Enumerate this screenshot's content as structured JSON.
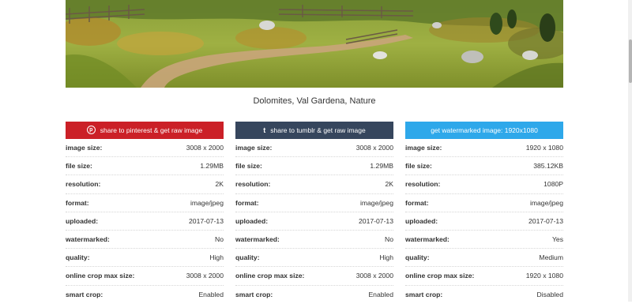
{
  "photo": {
    "alt": "Dolomites, Val Gardena, Nature"
  },
  "caption": "Dolomites, Val Gardena, Nature",
  "buttons": {
    "pinterest": "share to pinterest & get raw image",
    "tumblr": "share to tumblr & get raw image",
    "watermarked": "get watermarked image: 1920x1080"
  },
  "icons": {
    "pinterest": "p-icon",
    "tumblr": "t-icon"
  },
  "colors": {
    "pinterest": "#cb2027",
    "tumblr": "#36465d",
    "watermark": "#2ea8ea"
  },
  "labels": {
    "image_size": "image size:",
    "file_size": "file size:",
    "resolution": "resolution:",
    "format": "format:",
    "uploaded": "uploaded:",
    "watermarked": "watermarked:",
    "quality": "quality:",
    "crop_max": "online crop max size:",
    "smart_crop": "smart crop:"
  },
  "columns": [
    {
      "image_size": "3008 x 2000",
      "file_size": "1.29MB",
      "resolution": "2K",
      "format": "image/jpeg",
      "uploaded": "2017-07-13",
      "watermarked": "No",
      "quality": "High",
      "crop_max": "3008 x 2000",
      "smart_crop": "Enabled"
    },
    {
      "image_size": "3008 x 2000",
      "file_size": "1.29MB",
      "resolution": "2K",
      "format": "image/jpeg",
      "uploaded": "2017-07-13",
      "watermarked": "No",
      "quality": "High",
      "crop_max": "3008 x 2000",
      "smart_crop": "Enabled"
    },
    {
      "image_size": "1920 x 1080",
      "file_size": "385.12KB",
      "resolution": "1080P",
      "format": "image/jpeg",
      "uploaded": "2017-07-13",
      "watermarked": "Yes",
      "quality": "Medium",
      "crop_max": "1920 x 1080",
      "smart_crop": "Disabled"
    }
  ]
}
